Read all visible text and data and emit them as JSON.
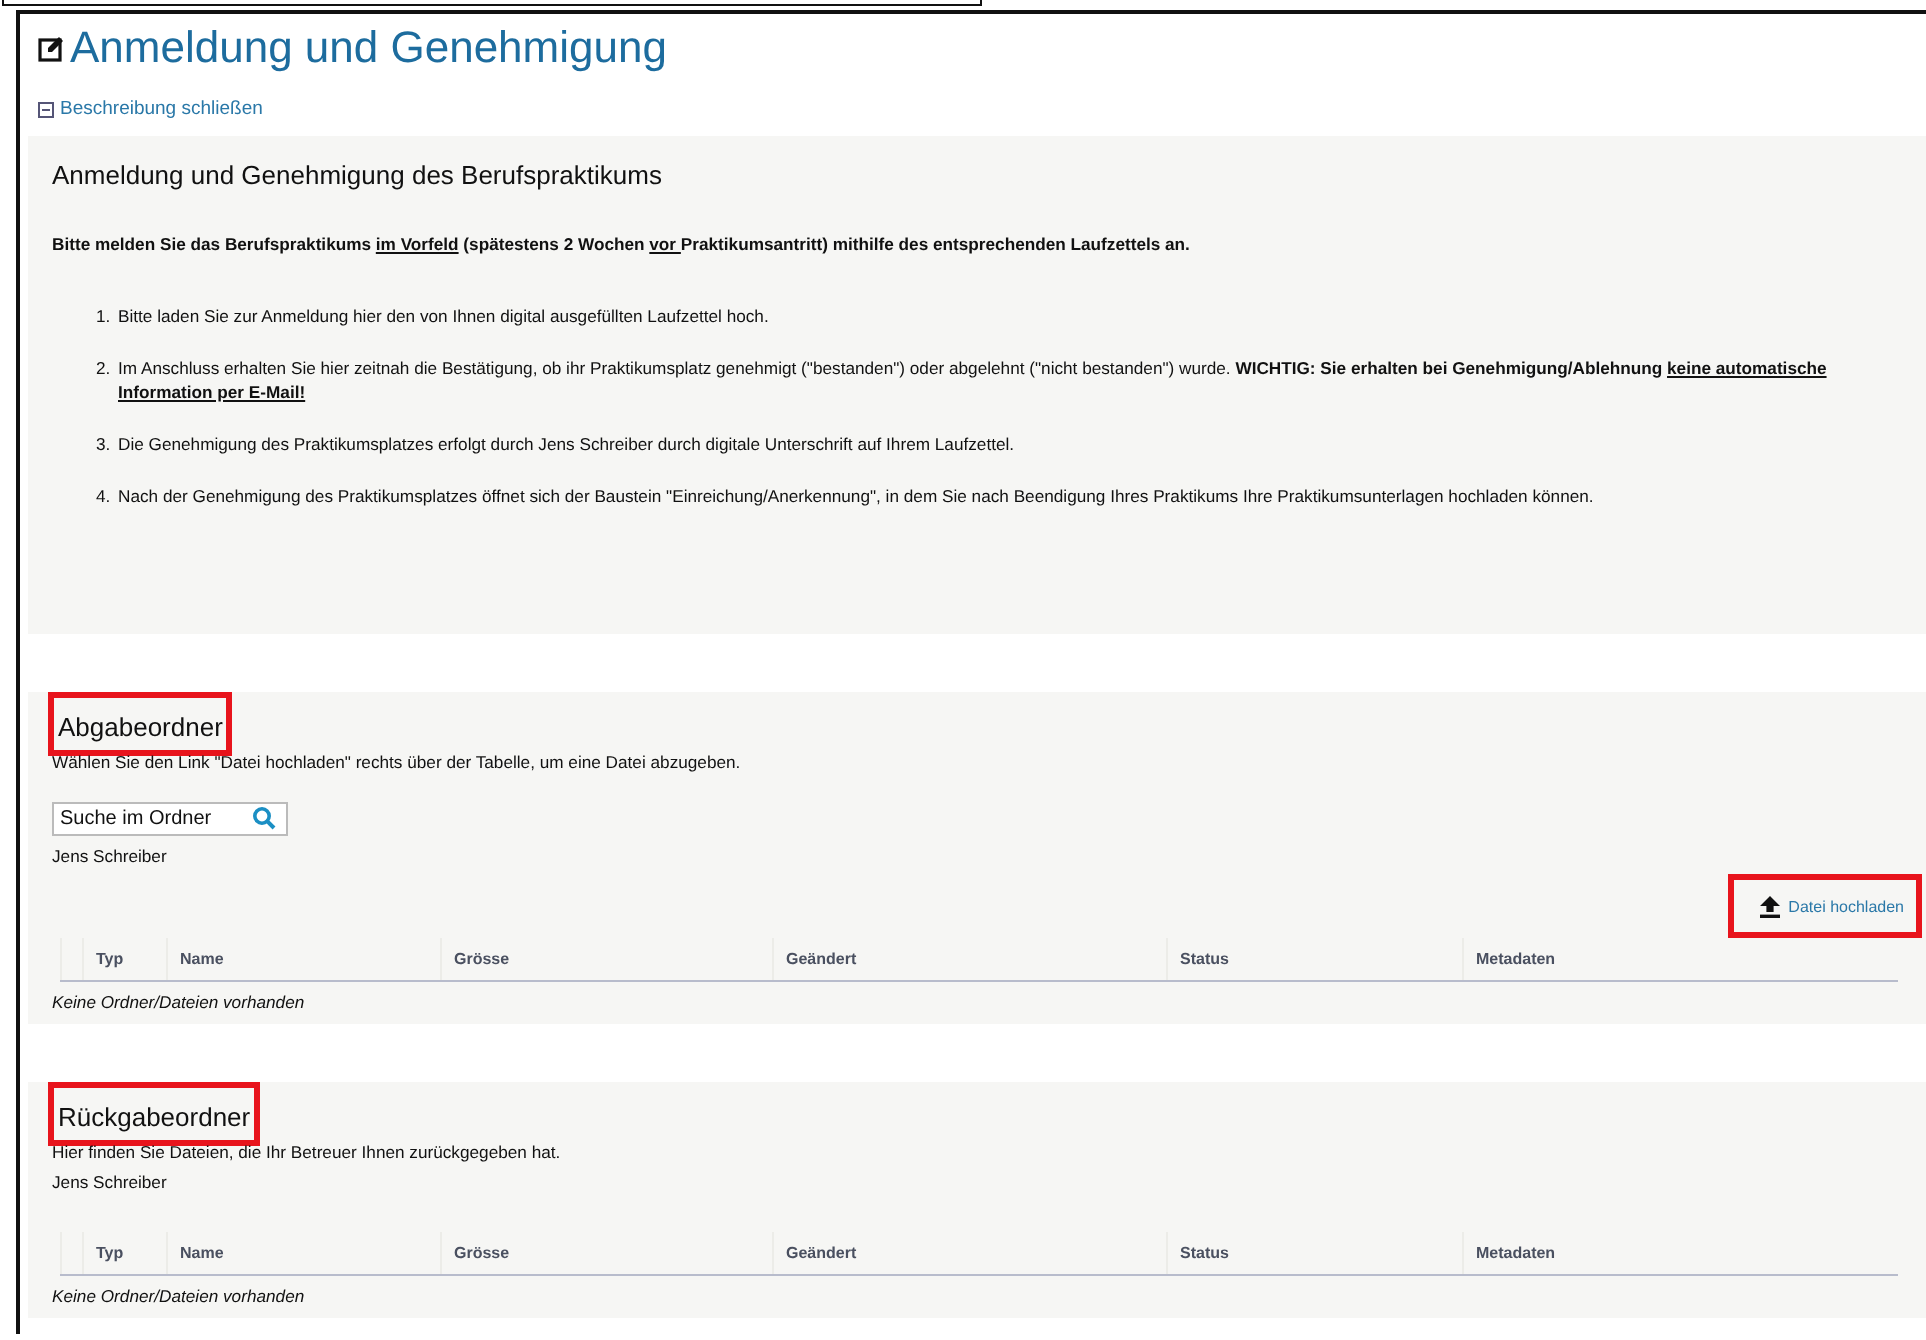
{
  "title": "Anmeldung und Genehmigung",
  "description_toggle": {
    "label": "Beschreibung schließen",
    "expanded": true
  },
  "description": {
    "heading": "Anmeldung und Genehmigung des Berufspraktikums",
    "intro": [
      {
        "text": "Bitte melden Sie das Berufspraktikums ",
        "bold": true,
        "underline": false
      },
      {
        "text": "im Vorfeld",
        "bold": true,
        "underline": true
      },
      {
        "text": " (spätestens 2 Wochen ",
        "bold": true,
        "underline": false
      },
      {
        "text": "vor ",
        "bold": true,
        "underline": true
      },
      {
        "text": "Praktikumsantritt) mithilfe des entsprechenden Laufzettels an.",
        "bold": true,
        "underline": false
      }
    ],
    "steps": [
      {
        "number": "1.",
        "parts": [
          {
            "text": "Bitte laden Sie zur Anmeldung hier den von Ihnen digital ausgefüllten Laufzettel hoch.",
            "bold": false,
            "underline": false
          }
        ]
      },
      {
        "number": "2.",
        "parts": [
          {
            "text": "Im Anschluss erhalten Sie hier zeitnah die Bestätigung, ob ihr Praktikumsplatz genehmigt (\"bestanden\") oder abgelehnt (\"nicht bestanden\") wurde. ",
            "bold": false,
            "underline": false
          },
          {
            "text": "WICHTIG: Sie erhalten bei Genehmigung/Ablehnung  ",
            "bold": true,
            "underline": false
          },
          {
            "text": "keine automatische Information per E-Mail!",
            "bold": true,
            "underline": true
          }
        ]
      },
      {
        "number": "3.",
        "parts": [
          {
            "text": "Die Genehmigung des Praktikumsplatzes erfolgt durch Jens Schreiber durch digitale Unterschrift auf Ihrem Laufzettel.",
            "bold": false,
            "underline": false
          }
        ]
      },
      {
        "number": "4.",
        "parts": [
          {
            "text": "Nach der Genehmigung des Praktikumsplatzes öffnet sich der Baustein \"Einreichung/Anerkennung\", in dem Sie nach Beendigung Ihres Praktikums Ihre Praktikumsunterlagen hochladen können.",
            "bold": false,
            "underline": false
          }
        ]
      }
    ]
  },
  "sections": [
    {
      "heading": "Abgabeordner",
      "highlighted": true,
      "hint": "Wählen Sie den Link \"Datei hochladen\" rechts über der Tabelle, um eine Datei abzugeben.",
      "search": {
        "placeholder": "Suche im Ordner"
      },
      "owner": "Jens Schreiber",
      "upload": {
        "label": "Datei hochladen",
        "highlighted": true
      },
      "columns": [
        "Typ",
        "Name",
        "Grösse",
        "Geändert",
        "Status",
        "Metadaten"
      ],
      "empty": "Keine Ordner/Dateien vorhanden"
    },
    {
      "heading": "Rückgabeordner",
      "highlighted": true,
      "hint": "Hier finden Sie Dateien, die Ihr Betreuer Ihnen zurückgegeben hat.",
      "owner": "Jens Schreiber",
      "columns": [
        "Typ",
        "Name",
        "Grösse",
        "Geändert",
        "Status",
        "Metadaten"
      ],
      "empty": "Keine Ordner/Dateien vorhanden"
    }
  ]
}
